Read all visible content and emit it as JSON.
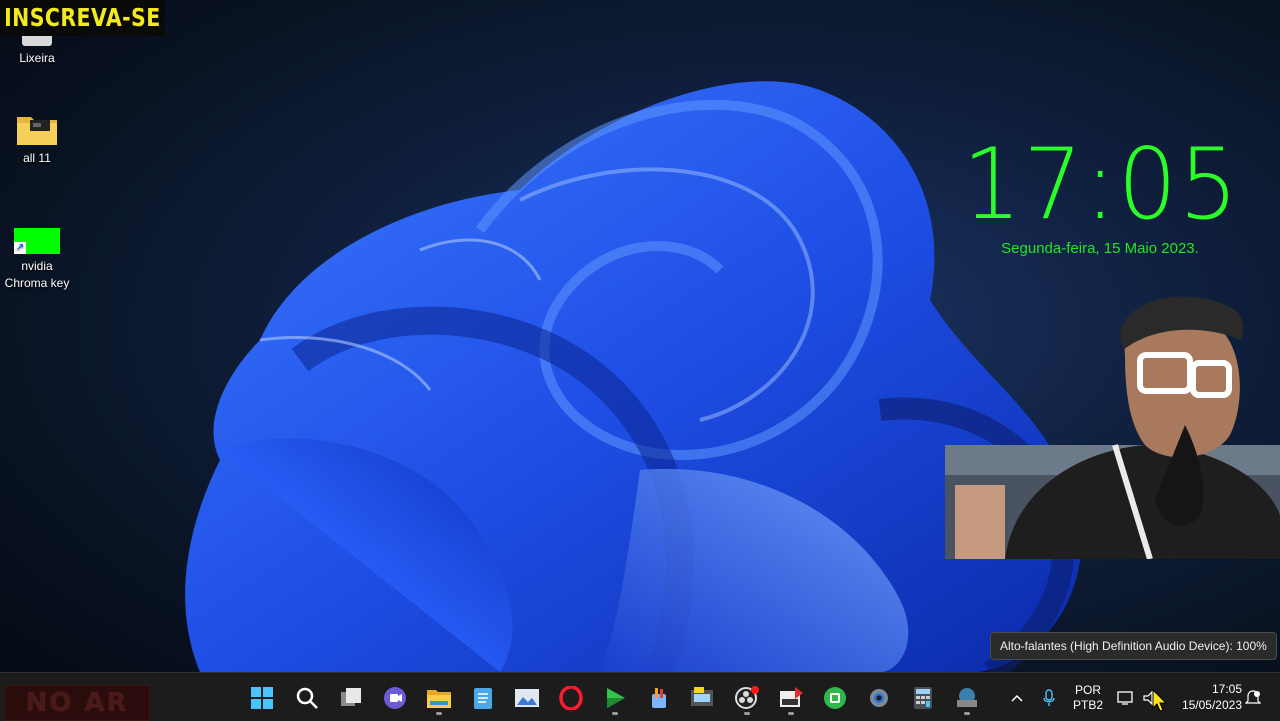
{
  "banner": {
    "text": "INSCREVA-SE"
  },
  "desktop": {
    "icons": [
      {
        "label": "Lixeira"
      },
      {
        "label": "all 11"
      },
      {
        "label": "nvidia Chroma key"
      }
    ]
  },
  "clock_widget": {
    "time": "17:05",
    "date": "Segunda-feira, 15 Maio 2023."
  },
  "tooltip": {
    "text": "Alto-falantes (High Definition Audio Device): 100%"
  },
  "taskbar": {
    "onair_label": "NO AR",
    "apps": [
      "start-icon",
      "search-icon",
      "task-view-icon",
      "teams-chat-icon",
      "file-explorer-icon",
      "notepad-icon",
      "photos-icon",
      "opera-icon",
      "media-player-icon",
      "paint-icon",
      "resources-icon",
      "obs-icon",
      "video-editor-icon",
      "green-app-icon",
      "settings-icon",
      "calculator-icon",
      "network-app-icon"
    ],
    "language": {
      "line1": "POR",
      "line2": "PTB2"
    },
    "clock": {
      "time": "17:05",
      "date": "15/05/2023"
    }
  },
  "colors": {
    "clock_green": "#2aff2a",
    "banner_yellow": "#f2ea1f",
    "taskbar_bg": "#1c1c1c",
    "chroma_green": "#00ff00"
  }
}
